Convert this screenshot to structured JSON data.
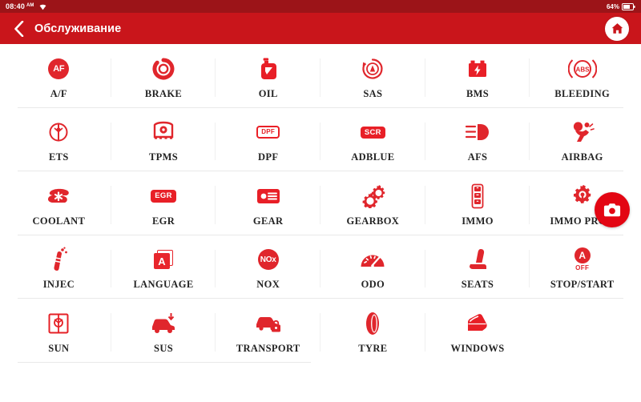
{
  "status_bar": {
    "time": "08:40",
    "ampm": "AM",
    "wifi_icon": "wifi-icon",
    "battery_percent": "64%",
    "battery_icon": "battery-icon"
  },
  "header": {
    "back_icon": "chevron-left-icon",
    "title": "Обслуживание",
    "home_icon": "home-icon",
    "background_color": "#c9151b"
  },
  "floating_button": {
    "name": "screenshot-button",
    "icon": "camera-icon",
    "color": "#e30613"
  },
  "theme": {
    "accent": "#e0262c",
    "header_red": "#c9151b",
    "statusbar_red": "#9c1418",
    "label_color": "#242424",
    "divider": "#e9e9e9"
  },
  "grid": {
    "columns": 6,
    "rows": [
      [
        {
          "label": "A/F",
          "icon": "af-badge-icon",
          "badge_text": "AF"
        },
        {
          "label": "BRAKE",
          "icon": "brake-disc-icon"
        },
        {
          "label": "OIL",
          "icon": "oil-canister-icon"
        },
        {
          "label": "SAS",
          "icon": "steering-angle-sensor-icon"
        },
        {
          "label": "BMS",
          "icon": "battery-management-icon"
        },
        {
          "label": "BLEEDING",
          "icon": "abs-icon",
          "badge_text": "ABS"
        }
      ],
      [
        {
          "label": "ETS",
          "icon": "ets-icon"
        },
        {
          "label": "TPMS",
          "icon": "tire-pressure-icon"
        },
        {
          "label": "DPF",
          "icon": "dpf-badge-icon",
          "badge_text": "DPF"
        },
        {
          "label": "ADBLUE",
          "icon": "scr-badge-icon",
          "badge_text": "SCR"
        },
        {
          "label": "AFS",
          "icon": "headlight-icon"
        },
        {
          "label": "AIRBAG",
          "icon": "airbag-icon"
        }
      ],
      [
        {
          "label": "COOLANT",
          "icon": "coolant-icon"
        },
        {
          "label": "EGR",
          "icon": "egr-badge-icon",
          "badge_text": "EGR"
        },
        {
          "label": "GEAR",
          "icon": "gear-card-icon"
        },
        {
          "label": "GEARBOX",
          "icon": "gearbox-cogs-icon"
        },
        {
          "label": "IMMO",
          "icon": "immo-key-fob-icon"
        },
        {
          "label": "IMMO PROG",
          "icon": "immo-prog-gear-key-icon"
        }
      ],
      [
        {
          "label": "INJEC",
          "icon": "fuel-injector-icon"
        },
        {
          "label": "LANGUAGE",
          "icon": "language-book-icon",
          "badge_text": "A"
        },
        {
          "label": "NOX",
          "icon": "nox-badge-icon",
          "badge_text": "NOx"
        },
        {
          "label": "ODO",
          "icon": "odometer-gauge-icon"
        },
        {
          "label": "SEATS",
          "icon": "car-seat-icon"
        },
        {
          "label": "STOP/START",
          "icon": "stop-start-icon",
          "badge_text": "A",
          "badge_sub": "OFF"
        }
      ],
      [
        {
          "label": "SUN",
          "icon": "sunroof-icon"
        },
        {
          "label": "SUS",
          "icon": "suspension-icon"
        },
        {
          "label": "TRANSPORT",
          "icon": "transport-lock-icon"
        },
        {
          "label": "TYRE",
          "icon": "tyre-icon"
        },
        {
          "label": "WINDOWS",
          "icon": "car-window-icon"
        },
        {
          "label": "",
          "icon": ""
        }
      ]
    ]
  }
}
